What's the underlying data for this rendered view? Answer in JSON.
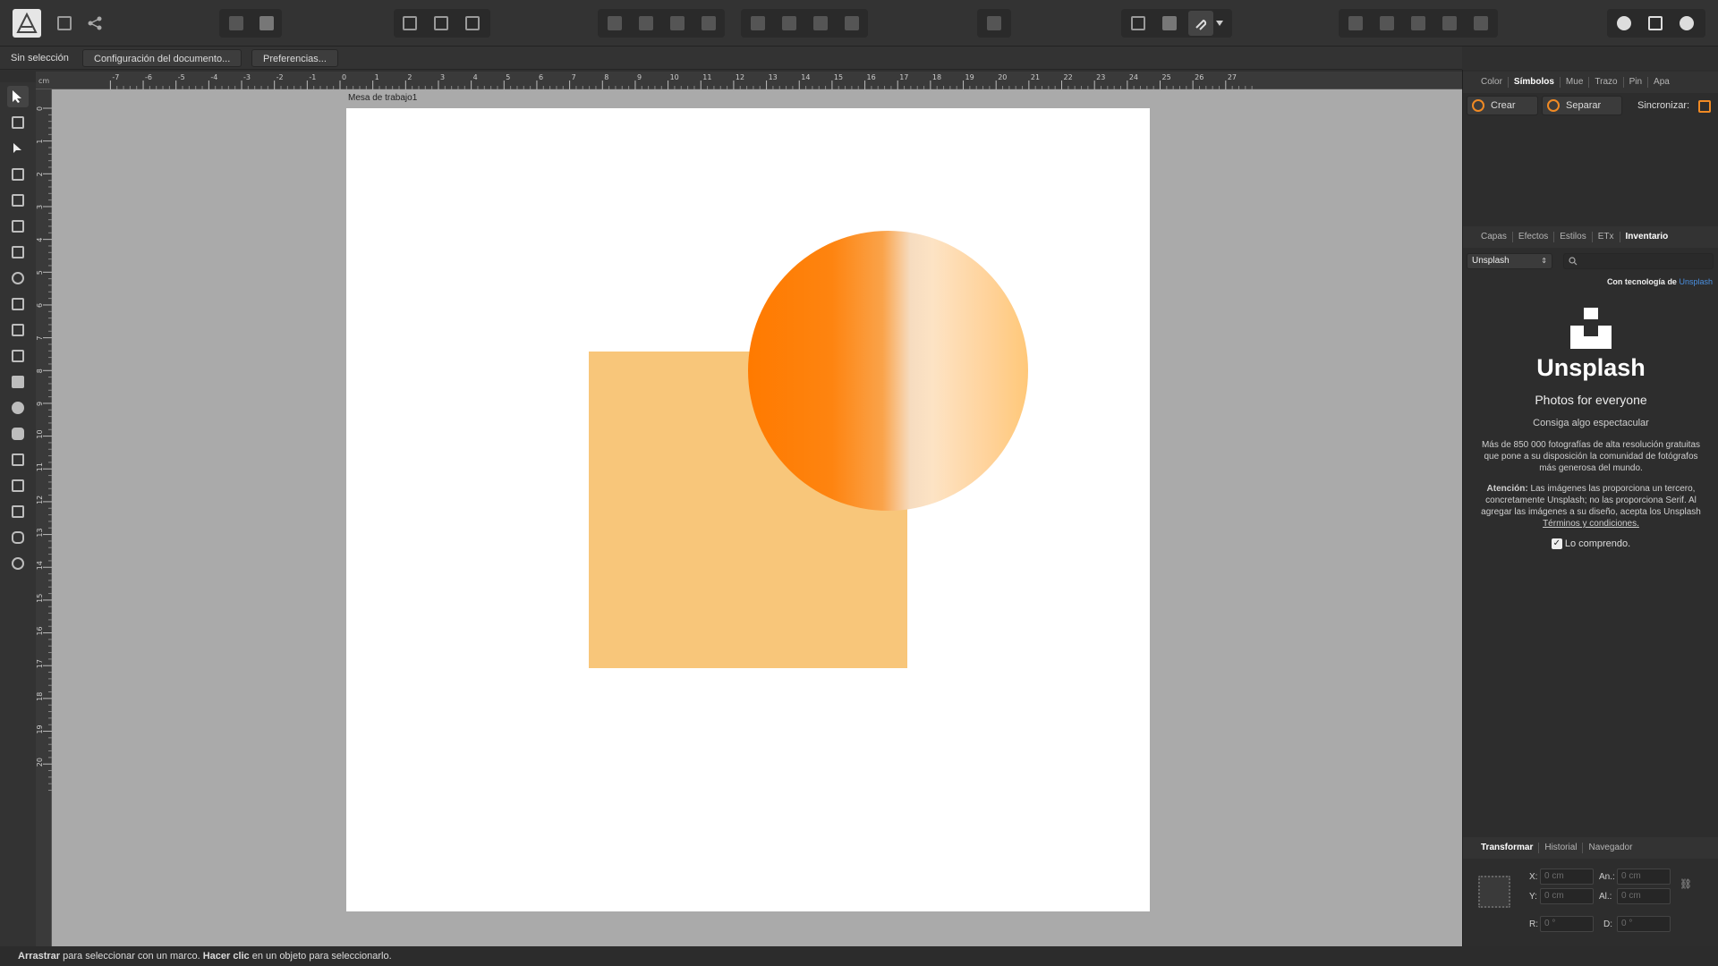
{
  "context_bar": {
    "selection": "Sin selección",
    "doc_setup": "Configuración del documento...",
    "preferences": "Preferencias..."
  },
  "canvas": {
    "artboard_label": "Mesa de trabajo1",
    "ruler_unit": "cm",
    "ruler_top_labels": [
      "-7",
      "-6",
      "-5",
      "-4",
      "-3",
      "-2",
      "-1",
      "0",
      "1",
      "2",
      "3",
      "4",
      "5",
      "6",
      "7",
      "8",
      "9",
      "10",
      "11",
      "12",
      "13",
      "14",
      "15",
      "16",
      "17",
      "18",
      "19",
      "20",
      "21",
      "22",
      "23",
      "24",
      "25",
      "26",
      "27"
    ],
    "ruler_left_labels": [
      "0",
      "1",
      "2",
      "3",
      "4",
      "5",
      "6",
      "7",
      "8",
      "9",
      "10",
      "11",
      "12",
      "13",
      "14",
      "15",
      "16",
      "17",
      "18",
      "19",
      "20"
    ],
    "colors": {
      "square": "#f8c67a",
      "circle_start": "#ff7a00",
      "circle_end": "#ffc879"
    }
  },
  "panels": {
    "top_tabs": [
      "Color",
      "Símbolos",
      "Mue",
      "Trazo",
      "Pin",
      "Apa"
    ],
    "top_active": "Símbolos",
    "create_label": "Crear",
    "separate_label": "Separar",
    "sync_label": "Sincronizar:",
    "mid_tabs": [
      "Capas",
      "Efectos",
      "Estilos",
      "ETx",
      "Inventario"
    ],
    "mid_active": "Inventario",
    "source_select": "Unsplash",
    "powered_by": "Con tecnología de",
    "powered_brand": "Unsplash",
    "brand_name": "Unsplash",
    "tagline": "Photos for everyone",
    "subtitle": "Consiga algo espectacular",
    "description": "Más de 850 000 fotografías de alta resolución gratuitas que pone a su disposición la comunidad de fotógrafos más generosa del mundo.",
    "warning_bold": "Atención:",
    "warning_text": "Las imágenes las proporciona un tercero, concretamente Unsplash; no las proporciona Serif. Al agregar las imágenes a su diseño, acepta los Unsplash",
    "terms_link": "Términos y condiciones.",
    "understood": "Lo comprendo.",
    "bottom_tabs": [
      "Transformar",
      "Historial",
      "Navegador"
    ],
    "bottom_active": "Transformar",
    "transform": {
      "x_label": "X:",
      "x_value": "0 cm",
      "y_label": "Y:",
      "y_value": "0 cm",
      "w_label": "An.:",
      "w_value": "0 cm",
      "h_label": "Al.:",
      "h_value": "0 cm",
      "r_label": "R:",
      "r_value": "0 °",
      "s_label": "D:",
      "s_value": "0 °"
    }
  },
  "status": {
    "drag_bold": "Arrastrar",
    "drag_text": "para seleccionar con un marco.",
    "click_bold": "Hacer clic",
    "click_text": "en un objeto para seleccionarlo."
  }
}
